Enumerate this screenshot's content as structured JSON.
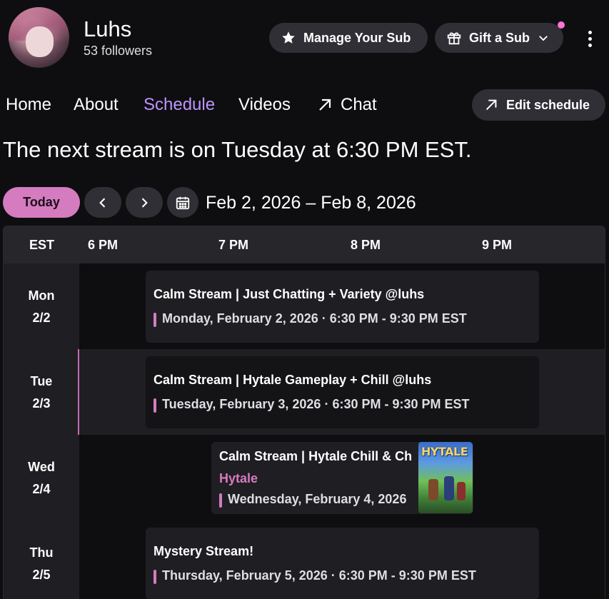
{
  "channel": {
    "name": "Luhs",
    "followers": "53 followers"
  },
  "header": {
    "manage_sub": "Manage Your Sub",
    "gift_sub": "Gift a Sub"
  },
  "nav": {
    "home": "Home",
    "about": "About",
    "schedule": "Schedule",
    "videos": "Videos",
    "chat": "Chat",
    "edit_schedule": "Edit schedule"
  },
  "next_stream": "The next stream is on Tuesday at 6:30 PM EST.",
  "controls": {
    "today": "Today",
    "date_range": "Feb 2, 2026 – Feb 8, 2026"
  },
  "schedule": {
    "timezone": "EST",
    "hours": [
      "6 PM",
      "7 PM",
      "8 PM",
      "9 PM"
    ],
    "days": [
      {
        "weekday": "Mon",
        "date": "2/2",
        "title": "Calm Stream | Just Chatting + Variety @luhs",
        "time": "Monday, February 2, 2026 · 6:30 PM - 9:30 PM EST"
      },
      {
        "weekday": "Tue",
        "date": "2/3",
        "title": "Calm Stream | Hytale Gameplay + Chill @luhs",
        "time": "Tuesday, February 3, 2026 · 6:30 PM - 9:30 PM EST"
      },
      {
        "weekday": "Wed",
        "date": "2/4",
        "title": "Calm Stream | Hytale Chill & Ch",
        "category": "Hytale",
        "time": "Wednesday, February 4, 2026",
        "thumbnail_text": "HYTALE"
      },
      {
        "weekday": "Thu",
        "date": "2/5",
        "title": "Mystery Stream!",
        "time": "Thursday, February 5, 2026 · 6:30 PM - 9:30 PM EST"
      }
    ]
  },
  "colors": {
    "accent_purple": "#bf94ff",
    "accent_pink": "#d57bc0",
    "background": "#0e0e10",
    "notification": "#ff73d9"
  }
}
